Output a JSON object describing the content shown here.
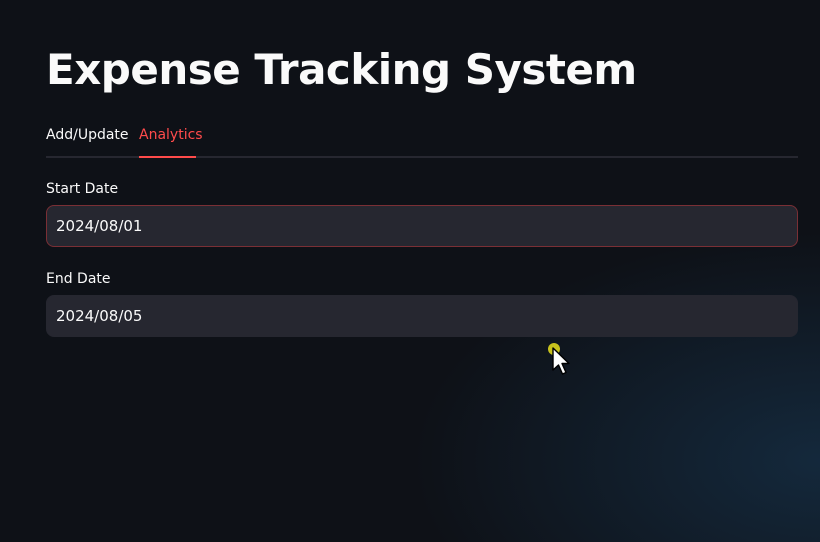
{
  "page": {
    "title": "Expense Tracking System"
  },
  "tabs": [
    {
      "label": "Add/Update",
      "active": false
    },
    {
      "label": "Analytics",
      "active": true
    }
  ],
  "form": {
    "start_date": {
      "label": "Start Date",
      "value": "2024/08/01"
    },
    "end_date": {
      "label": "End Date",
      "value": "2024/08/05"
    }
  },
  "colors": {
    "background": "#0e1117",
    "accent": "#ff4b4b",
    "input_background": "#262730",
    "text": "#fafafa"
  },
  "icons": {
    "cursor": "mouse-pointer-icon"
  }
}
